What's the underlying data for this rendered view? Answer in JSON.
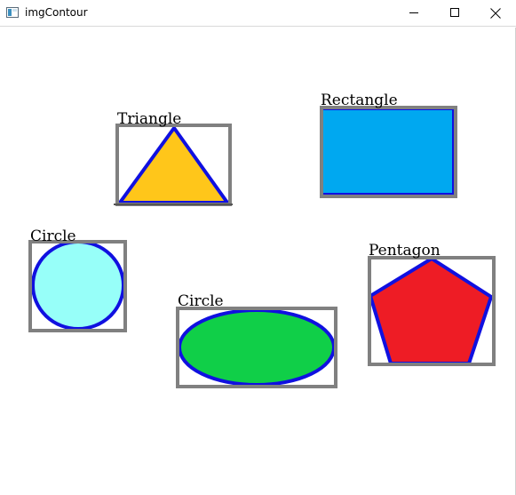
{
  "window": {
    "title": "imgContour",
    "icon": "app-window-icon",
    "controls": [
      "minimize-icon",
      "maximize-icon",
      "close-icon"
    ]
  },
  "shapes": [
    {
      "label": "Triangle",
      "fill": "#ffc61a",
      "outline": "#1010e0",
      "box": "#808080"
    },
    {
      "label": "Rectangle",
      "fill": "#00a8f0",
      "outline": "#1010e0",
      "box": "#808080"
    },
    {
      "label": "Circle",
      "fill": "#97fff9",
      "outline": "#1010e0",
      "box": "#808080"
    },
    {
      "label": "Circle",
      "fill": "#10cf48",
      "outline": "#1010e0",
      "box": "#808080"
    },
    {
      "label": "Pentagon",
      "fill": "#ee1c25",
      "outline": "#1010e0",
      "box": "#808080"
    }
  ]
}
